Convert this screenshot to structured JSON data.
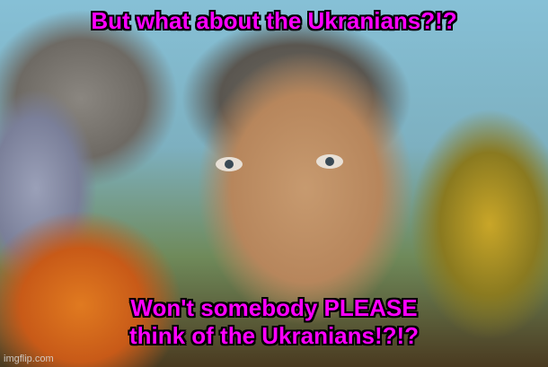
{
  "meme": {
    "top_text": "But what about the Ukranians?!?",
    "bottom_line1": "Won't somebody PLEASE",
    "bottom_line2": "think of the Ukranians!?!?",
    "text_color": "#ff00ff"
  },
  "watermark": "imgflip.com"
}
